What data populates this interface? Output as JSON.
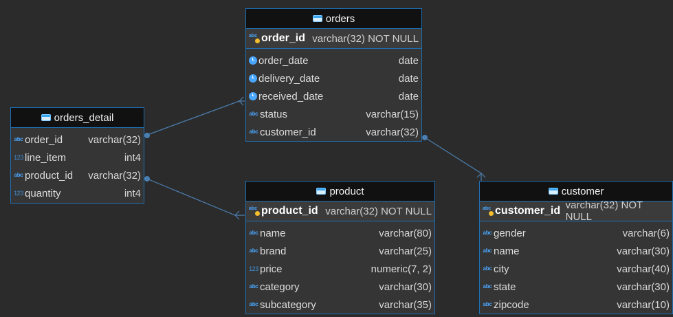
{
  "diagram": {
    "tables": {
      "orders": {
        "title": "orders",
        "primary_key": {
          "name": "order_id",
          "type": "varchar(32) NOT NULL",
          "icon": "string-key-icon"
        },
        "columns": [
          {
            "name": "order_date",
            "type": "date",
            "icon": "date-icon"
          },
          {
            "name": "delivery_date",
            "type": "date",
            "icon": "date-icon"
          },
          {
            "name": "received_date",
            "type": "date",
            "icon": "date-icon"
          },
          {
            "name": "status",
            "type": "varchar(15)",
            "icon": "string-icon"
          },
          {
            "name": "customer_id",
            "type": "varchar(32)",
            "icon": "string-icon"
          }
        ]
      },
      "orders_detail": {
        "title": "orders_detail",
        "columns": [
          {
            "name": "order_id",
            "type": "varchar(32)",
            "icon": "string-icon"
          },
          {
            "name": "line_item",
            "type": "int4",
            "icon": "number-icon"
          },
          {
            "name": "product_id",
            "type": "varchar(32)",
            "icon": "string-icon"
          },
          {
            "name": "quantity",
            "type": "int4",
            "icon": "number-icon"
          }
        ]
      },
      "product": {
        "title": "product",
        "primary_key": {
          "name": "product_id",
          "type": "varchar(32) NOT NULL",
          "icon": "string-key-icon"
        },
        "columns": [
          {
            "name": "name",
            "type": "varchar(80)",
            "icon": "string-icon"
          },
          {
            "name": "brand",
            "type": "varchar(25)",
            "icon": "string-icon"
          },
          {
            "name": "price",
            "type": "numeric(7, 2)",
            "icon": "number-icon"
          },
          {
            "name": "category",
            "type": "varchar(30)",
            "icon": "string-icon"
          },
          {
            "name": "subcategory",
            "type": "varchar(35)",
            "icon": "string-icon"
          }
        ]
      },
      "customer": {
        "title": "customer",
        "primary_key": {
          "name": "customer_id",
          "type": "varchar(32) NOT NULL",
          "icon": "string-key-icon"
        },
        "columns": [
          {
            "name": "gender",
            "type": "varchar(6)",
            "icon": "string-icon"
          },
          {
            "name": "name",
            "type": "varchar(30)",
            "icon": "string-icon"
          },
          {
            "name": "city",
            "type": "varchar(40)",
            "icon": "string-icon"
          },
          {
            "name": "state",
            "type": "varchar(30)",
            "icon": "string-icon"
          },
          {
            "name": "zipcode",
            "type": "varchar(10)",
            "icon": "string-icon"
          }
        ]
      }
    },
    "colors": {
      "background": "#2b2b2b",
      "table_border": "#1d6fb3",
      "table_header": "#111111",
      "table_body": "#353535",
      "text": "#dddddd",
      "accent": "#4aa7ff",
      "key_dot": "#f3bd2e"
    }
  }
}
